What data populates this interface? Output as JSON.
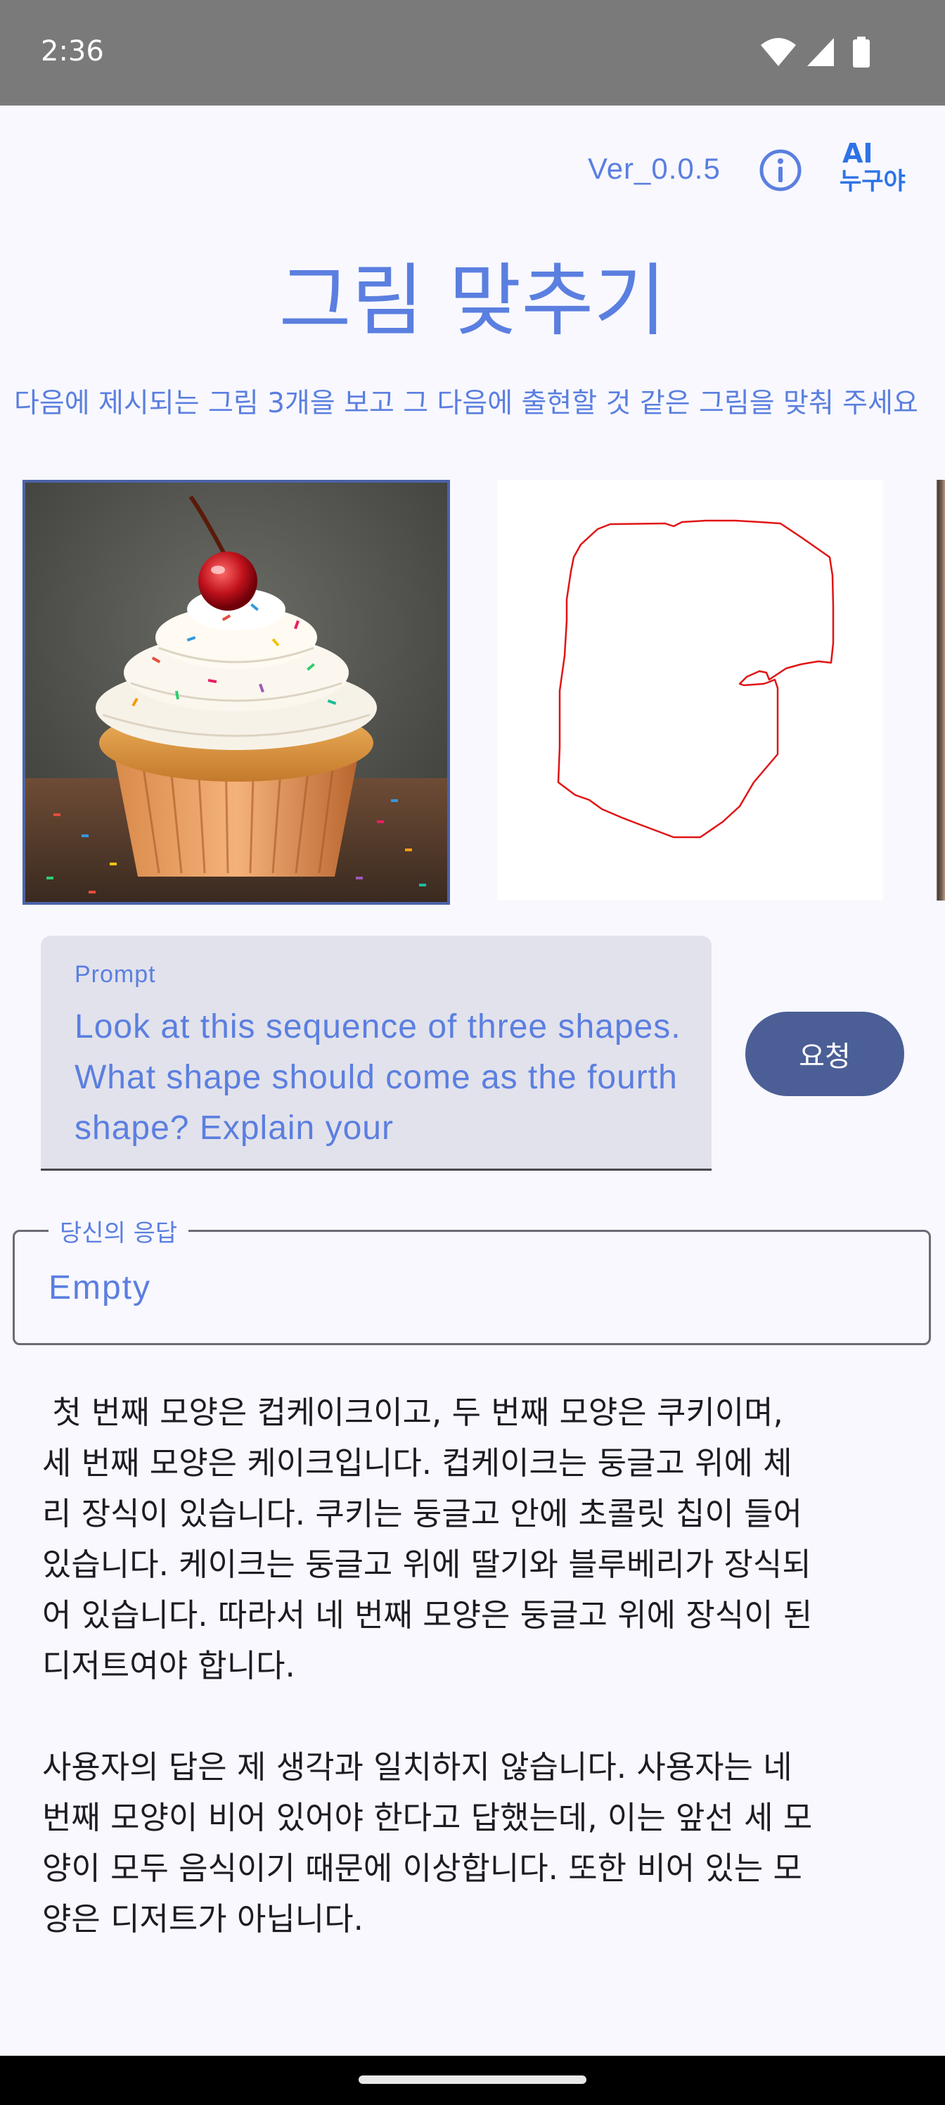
{
  "status_bar": {
    "time": "2:36",
    "icons": [
      "wifi-icon",
      "cellular-signal-icon",
      "battery-icon"
    ]
  },
  "header": {
    "version": "Ver_0.0.5",
    "info_icon": "info-icon",
    "logo": {
      "line1": "AI",
      "line2": "누구야"
    }
  },
  "page": {
    "title": "그림 맞추기",
    "instruction": "다음에 제시되는 그림 3개을 보고 그 다음에 출현할 것 같은 그림을 맞춰 주세요"
  },
  "images": [
    {
      "name": "cupcake-image",
      "selected": true
    },
    {
      "name": "red-outline-drawing",
      "selected": false
    },
    {
      "name": "third-image-partial",
      "selected": false
    }
  ],
  "prompt": {
    "label": "Prompt",
    "value": "Look at this sequence of three shapes. What shape should come as the fourth shape? Explain your"
  },
  "request_button": {
    "label": "요청"
  },
  "response": {
    "label": "당신의 응답",
    "value": "Empty"
  },
  "answer": {
    "text": " 첫 번째 모양은 컵케이크이고, 두 번째 모양은 쿠키이며,\n세 번째 모양은 케이크입니다. 컵케이크는 둥글고 위에 체\n리 장식이 있습니다. 쿠키는 둥글고 안에 초콜릿 칩이 들어\n있습니다. 케이크는 둥글고 위에 딸기와 블루베리가 장식되\n어 있습니다. 따라서 네 번째 모양은 둥글고 위에 장식이 된\n디저트여야 합니다.\n\n사용자의 답은 제 생각과 일치하지 않습니다. 사용자는 네\n번째 모양이 비어 있어야 한다고 답했는데, 이는 앞선 세 모\n양이 모두 음식이기 때문에 이상합니다. 또한 비어 있는 모\n양은 디저트가 아닙니다."
  },
  "colors": {
    "accent": "#5b7fe0",
    "button": "#4b5e96",
    "status_bar": "#7a7a7a",
    "background": "#f8f8fe"
  }
}
